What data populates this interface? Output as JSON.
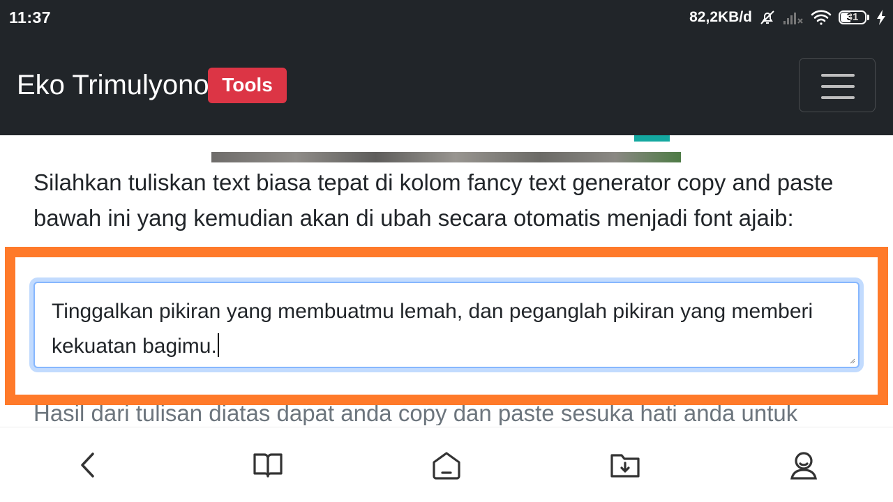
{
  "status_bar": {
    "time": "11:37",
    "network_speed": "82,2KB/d",
    "battery_level": "31",
    "icons": [
      "mute-bell-icon",
      "signal-icon",
      "wifi-icon",
      "battery-icon",
      "charging-icon"
    ]
  },
  "navbar": {
    "brand": "Eko Trimulyono",
    "badge": "Tools",
    "badge_color": "#dc3545",
    "background": "#212529",
    "menu_icon": "hamburger-icon"
  },
  "content": {
    "intro": "Silahkan tuliskan text biasa tepat di kolom fancy text generator copy and paste bawah ini yang kemudian akan di ubah secara otomatis menjadi font ajaib:",
    "input_value": "Tinggalkan pikiran yang membuatmu lemah, dan peganglah pikiran yang memberi kekuatan bagimu.",
    "result_hint": "Hasil dari tulisan diatas dapat anda copy dan paste sesuka hati anda untuk digunakan"
  },
  "highlight_color": "#ff7a2a",
  "bottom_bar": {
    "buttons": [
      "back-icon",
      "book-icon",
      "home-icon",
      "download-folder-icon",
      "profile-icon"
    ]
  }
}
